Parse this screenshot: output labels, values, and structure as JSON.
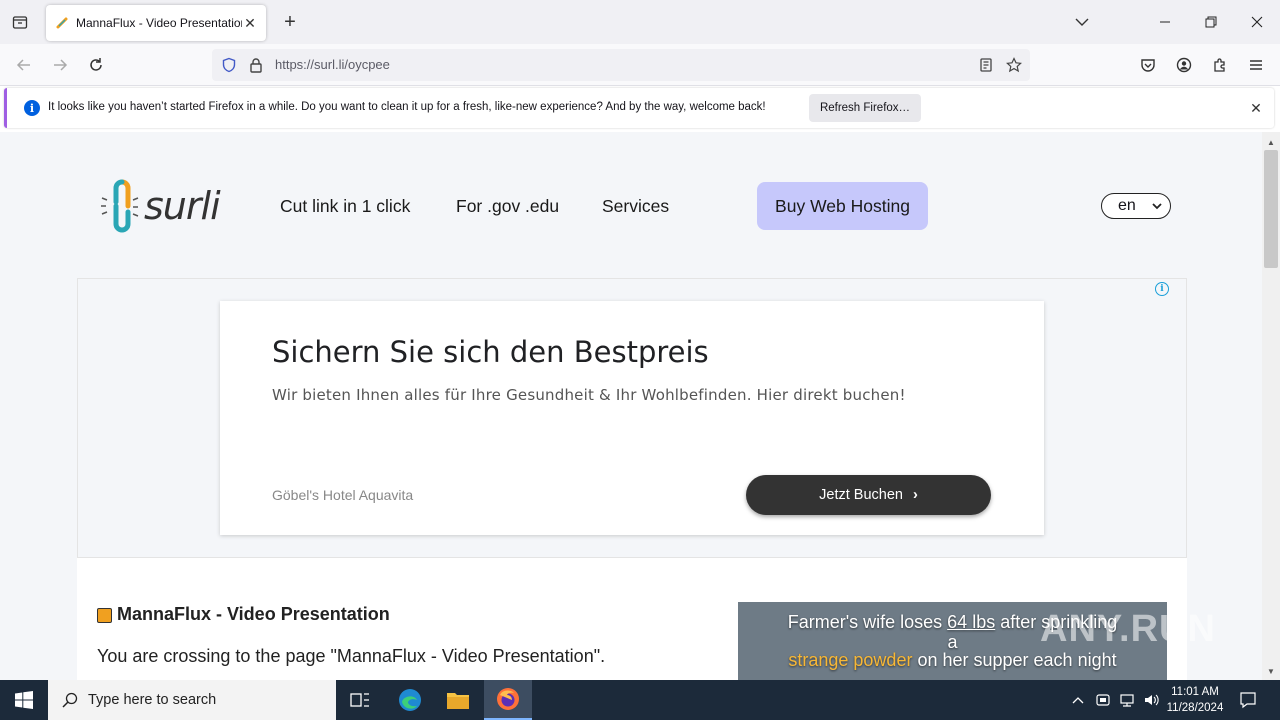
{
  "browser": {
    "tab": {
      "title": "MannaFlux - Video Presentation"
    },
    "url": "https://surl.li/oycpee"
  },
  "notification": {
    "message": "It looks like you haven’t started Firefox in a while. Do you want to clean it up for a fresh, like-new experience? And by the way, welcome back!",
    "button_label": "Refresh Firefox…"
  },
  "site": {
    "logo_text": "surli",
    "menu": [
      "Cut link in 1 click",
      "For .gov .edu",
      "Services"
    ],
    "hosting_button": "Buy Web Hosting",
    "language": "en"
  },
  "ad": {
    "headline": "Sichern Sie sich den Bestpreis",
    "description": "Wir bieten Ihnen alles für Ihre Gesundheit & Ihr Wohlbefinden. Hier direkt buchen!",
    "advertiser": "Göbel's Hotel Aquavita",
    "cta": "Jetzt Buchen"
  },
  "content": {
    "title": "MannaFlux - Video Presentation",
    "description": "You are crossing to the page \"MannaFlux - Video Presentation\"."
  },
  "promo": {
    "line1_a": "Farmer's wife loses ",
    "line1_u": "64 lbs",
    "line1_b": " after sprinkling",
    "line2": "a",
    "line3_hl": "strange powder",
    "line3_b": " on her supper each night"
  },
  "watermark": "ANY.RUN",
  "taskbar": {
    "search_placeholder": "Type here to search",
    "time": "11:01 AM",
    "date": "11/28/2024"
  },
  "colors": {
    "hosting_button_bg": "#c6c8fb",
    "notification_accent": "#9f5fe3",
    "info_blue": "#0060df",
    "promo_highlight": "#f7b736",
    "taskbar_bg": "#1c2a3a"
  }
}
